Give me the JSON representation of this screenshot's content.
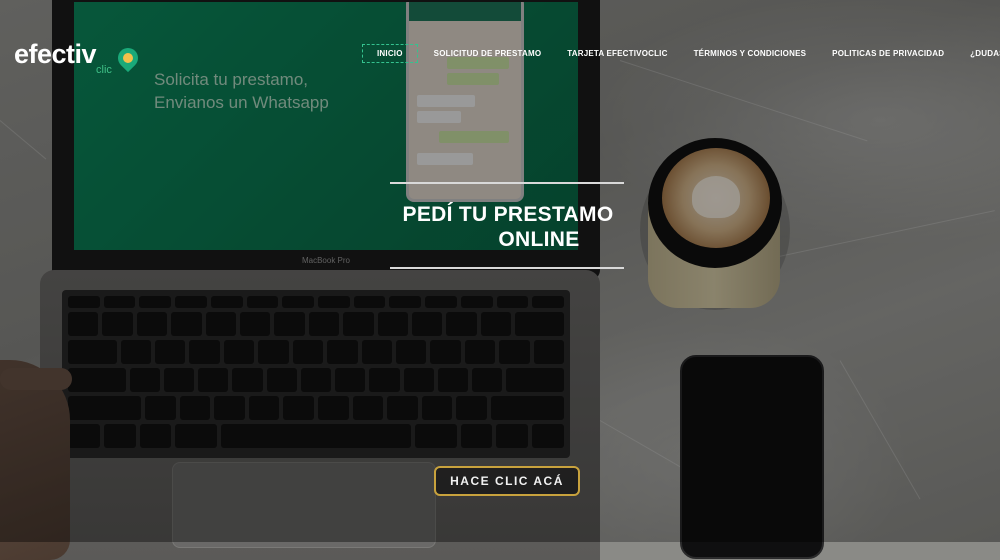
{
  "brand": {
    "logo_main": "efectiv",
    "logo_sub": "clic",
    "accent": "#1aa979",
    "accent_secondary": "#f3c14b"
  },
  "nav": {
    "items": [
      {
        "label": "INICIO",
        "active": true
      },
      {
        "label": "SOLICITUD DE PRESTAMO"
      },
      {
        "label": "TARJETA EFECTIVOCLIC"
      },
      {
        "label": "TÉRMINOS Y CONDICIONES"
      },
      {
        "label": "POLITICAS DE PRIVACIDAD"
      },
      {
        "label": "¿DUDAS?"
      }
    ]
  },
  "laptop_screen": {
    "line1": "Solicita tu prestamo,",
    "line2": "Envianos un Whatsapp"
  },
  "laptop_label": "MacBook Pro",
  "hero": {
    "title_line1": "PEDÍ TU PRESTAMO",
    "title_line2": "ONLINE"
  },
  "cta": {
    "label": "HACE CLIC ACÁ",
    "border_color": "#c8a23d"
  }
}
